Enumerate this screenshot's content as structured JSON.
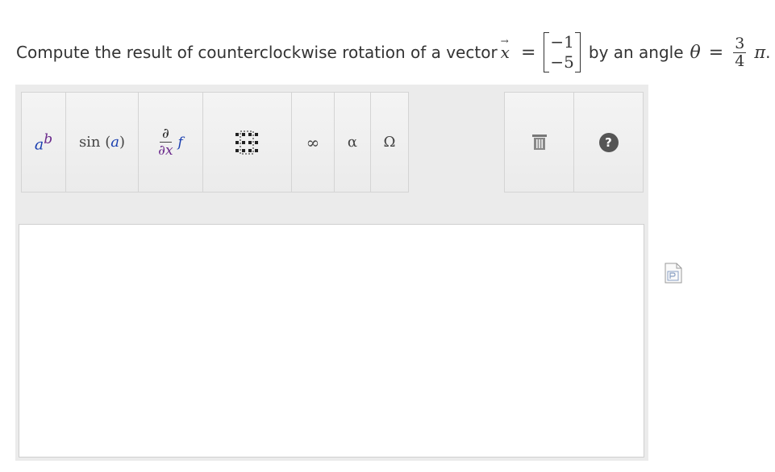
{
  "question": {
    "prefix": "Compute the result of counterclockwise rotation of a vector",
    "vector_symbol": "x",
    "vector_arrow": "→",
    "equals": "=",
    "matrix": [
      "−1",
      "−5"
    ],
    "middle": "by an angle",
    "theta": "θ",
    "equals2": "=",
    "frac_num": "3",
    "frac_den": "4",
    "pi": "π",
    "suffix": "."
  },
  "toolbar": {
    "power": {
      "base": "a",
      "exp": "b",
      "icon": "superscript-icon"
    },
    "sin": {
      "fn": "sin",
      "open": "(",
      "arg": "a",
      "close": ")"
    },
    "partial": {
      "top": "∂",
      "bottom": "∂x",
      "f": "f"
    },
    "matrix_icon": "matrix-icon",
    "infinity": "∞",
    "alpha": "α",
    "omega": "Ω",
    "trash_icon": "trash-icon",
    "help": "?"
  },
  "colors": {
    "panel": "#ebebeb",
    "button": "#f0f0f0",
    "border": "#d4d4d4",
    "math_blue": "#1a3fb0",
    "math_purple": "#6b2a8c",
    "help_bg": "#555555"
  }
}
